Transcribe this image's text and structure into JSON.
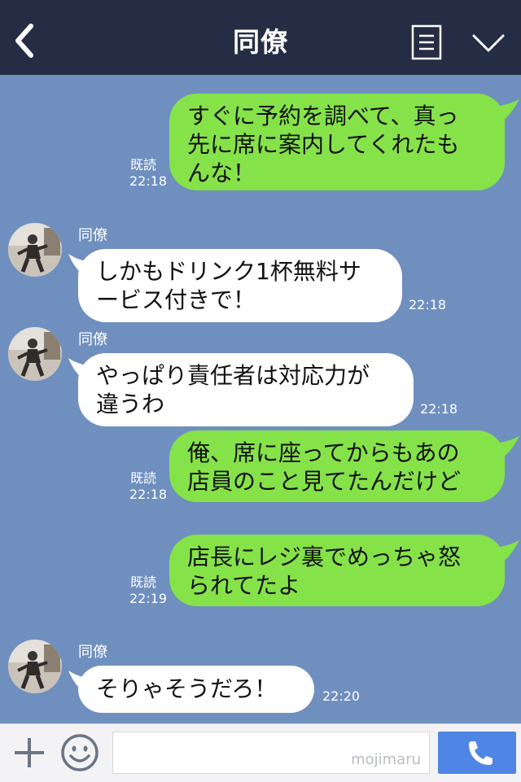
{
  "header": {
    "title": "同僚"
  },
  "messages": [
    {
      "side": "right",
      "lines": [
        "すぐに予約を調べて、真っ",
        "先に席に案内してくれたも",
        "んな！"
      ],
      "read": "既読",
      "time": "22:18"
    },
    {
      "side": "left",
      "sender": "同僚",
      "lines": [
        "しかもドリンク1杯無料サ",
        "ービス付きで！"
      ],
      "time": "22:18"
    },
    {
      "side": "left",
      "sender": "同僚",
      "lines": [
        "やっぱり責任者は対応力が",
        "違うわ"
      ],
      "time": "22:18"
    },
    {
      "side": "right",
      "lines": [
        "俺、席に座ってからもあの",
        "店員のこと見てたんだけど"
      ],
      "read": "既読",
      "time": "22:18"
    },
    {
      "side": "right",
      "lines": [
        "店長にレジ裏でめっちゃ怒",
        "られてたよ"
      ],
      "read": "既読",
      "time": "22:19"
    },
    {
      "side": "left",
      "sender": "同僚",
      "lines": [
        "そりゃそうだろ！"
      ],
      "time": "22:20"
    }
  ],
  "input": {
    "placeholder": "",
    "watermark": "mojimaru"
  },
  "colors": {
    "header": "#252d44",
    "background": "#6f8fbf",
    "right_bubble": "#85e249",
    "left_bubble": "#ffffff",
    "call_button": "#4f86e6"
  },
  "icons": {
    "back": "chevron-left-icon",
    "menu": "menu-icon",
    "collapse": "chevron-down-icon",
    "plus": "plus-icon",
    "emoji": "smiley-icon",
    "call": "phone-icon"
  }
}
